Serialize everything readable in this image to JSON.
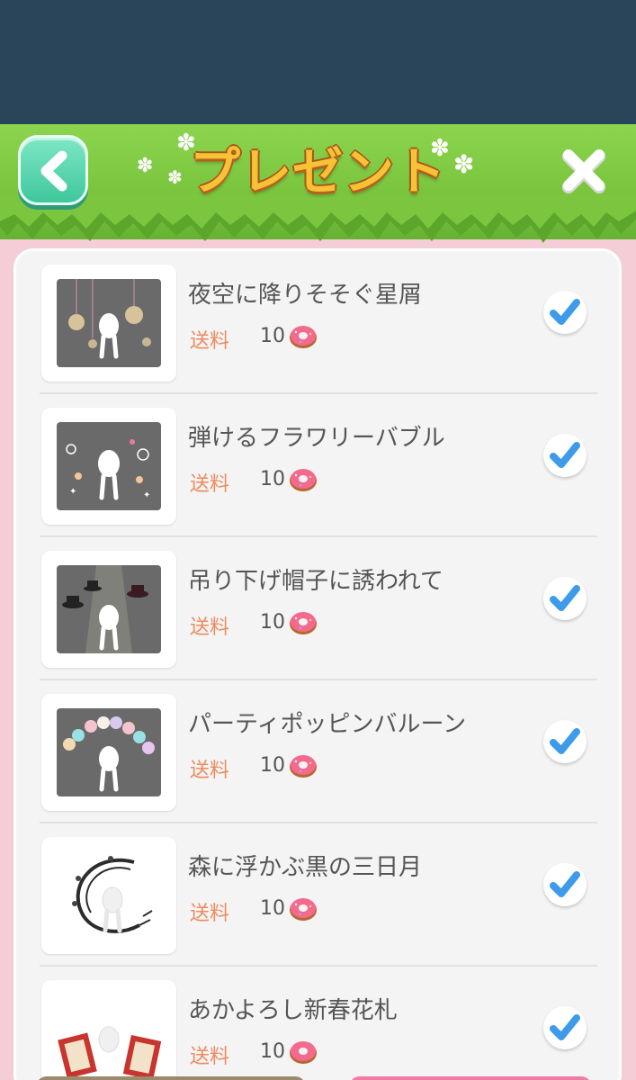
{
  "header": {
    "title": "プレゼント"
  },
  "icons": {
    "back": "chevron-left-icon",
    "close": "close-icon",
    "check": "checkmark-icon",
    "donut": "donut-icon"
  },
  "colors": {
    "header_green": "#7cc63f",
    "title_gold": "#f8c236",
    "panel_pink": "#f5cdd6",
    "check_blue": "#3d9be9",
    "ship_orange": "#ee8a5d"
  },
  "presents": [
    {
      "name": "夜空に降りそそぐ星屑",
      "ship_label": "送料",
      "ship_count": "10",
      "selected": true
    },
    {
      "name": "弾けるフラワリーバブル",
      "ship_label": "送料",
      "ship_count": "10",
      "selected": true
    },
    {
      "name": "吊り下げ帽子に誘われて",
      "ship_label": "送料",
      "ship_count": "10",
      "selected": true
    },
    {
      "name": "パーティポッピンバルーン",
      "ship_label": "送料",
      "ship_count": "10",
      "selected": true
    },
    {
      "name": "森に浮かぶ黒の三日月",
      "ship_label": "送料",
      "ship_count": "10",
      "selected": true
    },
    {
      "name": "あかよろし新春花札",
      "ship_label": "送料",
      "ship_count": "10",
      "selected": true
    }
  ]
}
